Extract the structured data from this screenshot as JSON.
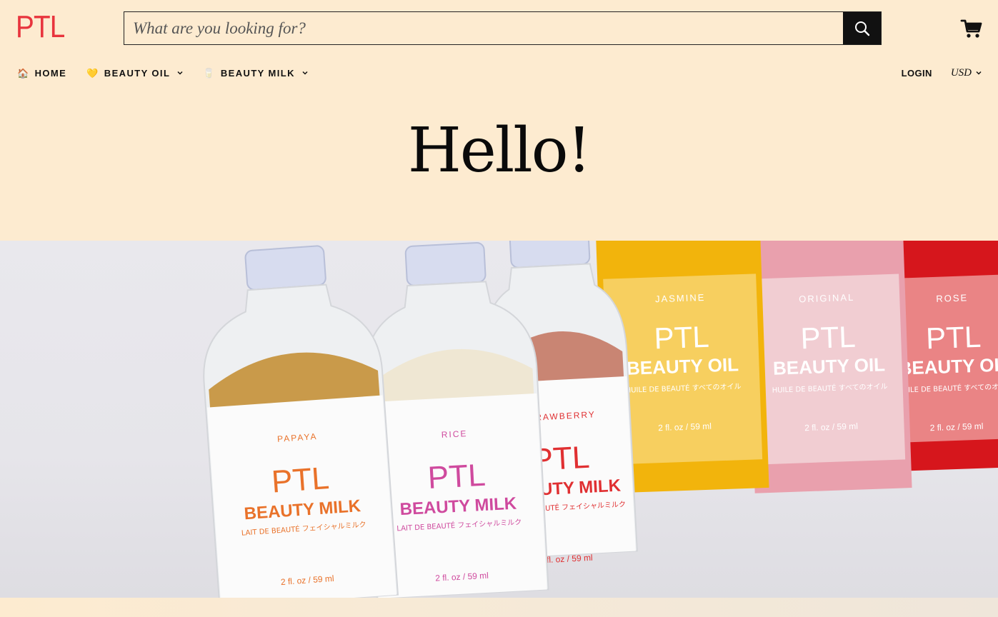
{
  "brand": {
    "logo_text": "PTL",
    "accent_color": "#e8343d",
    "background_color": "#fdebd0"
  },
  "search": {
    "placeholder": "What are you looking for?",
    "button_icon": "search-icon"
  },
  "header": {
    "cart_icon": "cart-icon"
  },
  "nav": {
    "items": [
      {
        "emoji": "🏠",
        "label": "HOME",
        "has_dropdown": false
      },
      {
        "emoji": "💛",
        "label": "BEAUTY OIL",
        "has_dropdown": true
      },
      {
        "emoji": "🥛",
        "label": "BEAUTY MILK",
        "has_dropdown": true
      }
    ],
    "login_label": "LOGIN",
    "currency_label": "USD"
  },
  "hero": {
    "title": "Hello!"
  },
  "banner": {
    "bottles": [
      {
        "flavor": "PAPAYA",
        "brand": "PTL",
        "product": "BEAUTY MILK",
        "subtitle": "LAIT DE BEAUTÉ フェイシャルミルク",
        "size": "2 fl. oz / 59 ml",
        "label_color": "#e9722a",
        "contents_color": "#c99a4a"
      },
      {
        "flavor": "RICE",
        "brand": "PTL",
        "product": "BEAUTY MILK",
        "subtitle": "LAIT DE BEAUTÉ フェイシャルミルク",
        "size": "2 fl. oz / 59 ml",
        "label_color": "#cf4a9e",
        "contents_color": "#efe7d3"
      },
      {
        "flavor": "STRAWBERRY",
        "brand": "PTL",
        "product": "BEAUTY MILK",
        "subtitle": "LAIT DE BEAUTÉ フェイシャルミルク",
        "size": "2 fl. oz / 59 ml",
        "label_color": "#e03032",
        "contents_color": "#c98573"
      },
      {
        "flavor": "JASMINE",
        "brand": "PTL",
        "product": "BEAUTY OIL",
        "subtitle": "HUILE DE BEAUTÉ すべてのオイル",
        "size": "2 fl. oz / 59 ml",
        "label_color": "#fbe6a4",
        "contents_color": "#f2b40c"
      },
      {
        "flavor": "ORIGINAL",
        "brand": "PTL",
        "product": "BEAUTY OIL",
        "subtitle": "HUILE DE BEAUTÉ すべてのオイル",
        "size": "2 fl. oz / 59 ml",
        "label_color": "#f8f2f1",
        "contents_color": "#e9a0ad"
      },
      {
        "flavor": "ROSE",
        "brand": "PTL",
        "product": "BEAUTY OIL",
        "subtitle": "HUILE DE BEAUTÉ すべてのオイル",
        "size": "2 fl. oz / 59 ml",
        "label_color": "#fbe0dc",
        "contents_color": "#d6161c"
      }
    ]
  }
}
